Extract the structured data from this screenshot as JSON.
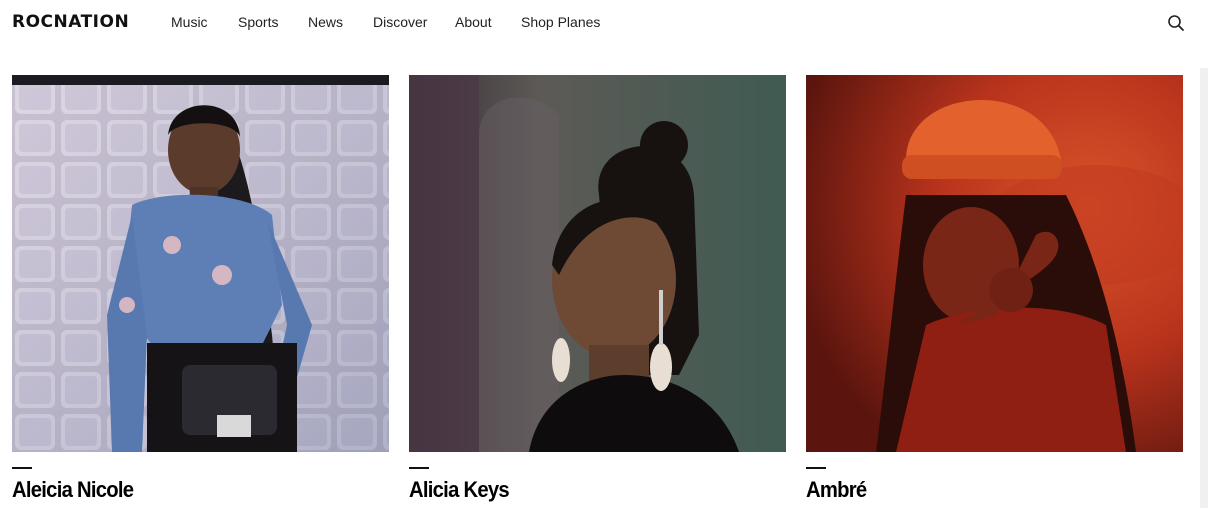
{
  "header": {
    "logo": "ROCNATION",
    "nav": [
      "Music",
      "Sports",
      "News",
      "Discover",
      "About",
      "Shop Planes"
    ],
    "search_icon": "search-icon"
  },
  "artists": [
    {
      "name": "Aleicia Nicole",
      "photo": "portrait photo, blue angel-print top, iridescent tiled wall"
    },
    {
      "name": "Alicia Keys",
      "photo": "portrait photo, drop earrings, dark green backdrop"
    },
    {
      "name": "Ambré",
      "photo": "portrait photo, orange knit beanie, red lighting"
    }
  ],
  "colors": {
    "text": "#111111",
    "background": "#ffffff",
    "rule": "#111111"
  }
}
